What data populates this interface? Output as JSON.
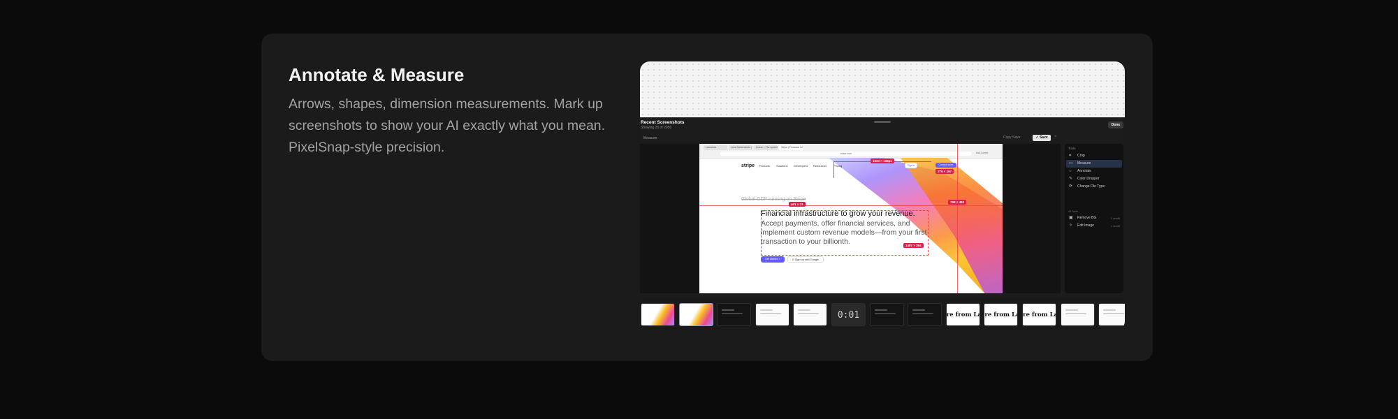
{
  "feature": {
    "title": "Annotate & Measure",
    "description": "Arrows, shapes, dimension measurements. Mark up screenshots to show your AI exactly what you mean. PixelSnap-style precision."
  },
  "app": {
    "header_title": "Recent Screenshots",
    "header_subtitle": "Showing 25 of 2956",
    "done_label": "Done",
    "toolbar_mode_label": "Measure",
    "copy_label": "Copy Save",
    "save_label": "✓ Save",
    "close_icon": "×"
  },
  "browser": {
    "tabs": [
      "Launches",
      "Luxs Screenshots | ...",
      "Linear – The system...",
      "Stripe | Financial Infr..."
    ],
    "url": "stripe.com",
    "right_label": "Ask Comet"
  },
  "stripe_page": {
    "logo": "stripe",
    "nav": [
      "Products",
      "Solutions",
      "Developers",
      "Resources",
      "Pricing"
    ],
    "signin": "Sign in",
    "contact": "Contact sales",
    "eyebrow": "Global GDP running on Stripe",
    "headline": "Financial infrastructure to grow your revenue.",
    "body": "Accept payments, offer financial services, and implement custom revenue models—from your first transaction to your billionth.",
    "cta_primary": "Get started >",
    "cta_secondary": "G Sign up with Google"
  },
  "measurements": {
    "top": "1060 × 188px",
    "right_top": "376 × 167",
    "left": "461 × 21",
    "center": "798 × 453",
    "bottom": "1487 × 394"
  },
  "tools_panel": {
    "heading": "Tools",
    "tools": [
      {
        "icon": "crop-icon",
        "glyph": "⌗",
        "label": "Crop"
      },
      {
        "icon": "measure-icon",
        "glyph": "▭",
        "label": "Measure"
      },
      {
        "icon": "annotate-icon",
        "glyph": "○",
        "label": "Annotate"
      },
      {
        "icon": "color-dropper-icon",
        "glyph": "✎",
        "label": "Color Dropper"
      },
      {
        "icon": "change-file-type-icon",
        "glyph": "⟳",
        "label": "Change File Type"
      }
    ],
    "ai_heading": "AI Tools",
    "ai_tools": [
      {
        "icon": "remove-bg-icon",
        "glyph": "▣",
        "label": "Remove BG",
        "credit": "1 credit"
      },
      {
        "icon": "edit-image-icon",
        "glyph": "✧",
        "label": "Edit Image",
        "credit": "1 credit"
      }
    ]
  },
  "thumbnails": [
    {
      "style": "t-stripe",
      "selected": false,
      "text": ""
    },
    {
      "style": "t-stripe",
      "selected": true,
      "text": ""
    },
    {
      "style": "t-dark",
      "selected": false,
      "text": ""
    },
    {
      "style": "t-light",
      "selected": false,
      "text": ""
    },
    {
      "style": "t-light",
      "selected": false,
      "text": ""
    },
    {
      "style": "t-code",
      "selected": false,
      "text": "0:01"
    },
    {
      "style": "t-dark",
      "selected": false,
      "text": ""
    },
    {
      "style": "t-dark",
      "selected": false,
      "text": ""
    },
    {
      "style": "t-text",
      "selected": false,
      "text": "re from Lazy"
    },
    {
      "style": "t-text",
      "selected": false,
      "text": "re from Laz"
    },
    {
      "style": "t-text",
      "selected": false,
      "text": "re from Laz"
    },
    {
      "style": "t-light",
      "selected": false,
      "text": ""
    },
    {
      "style": "t-light",
      "selected": false,
      "text": ""
    }
  ]
}
